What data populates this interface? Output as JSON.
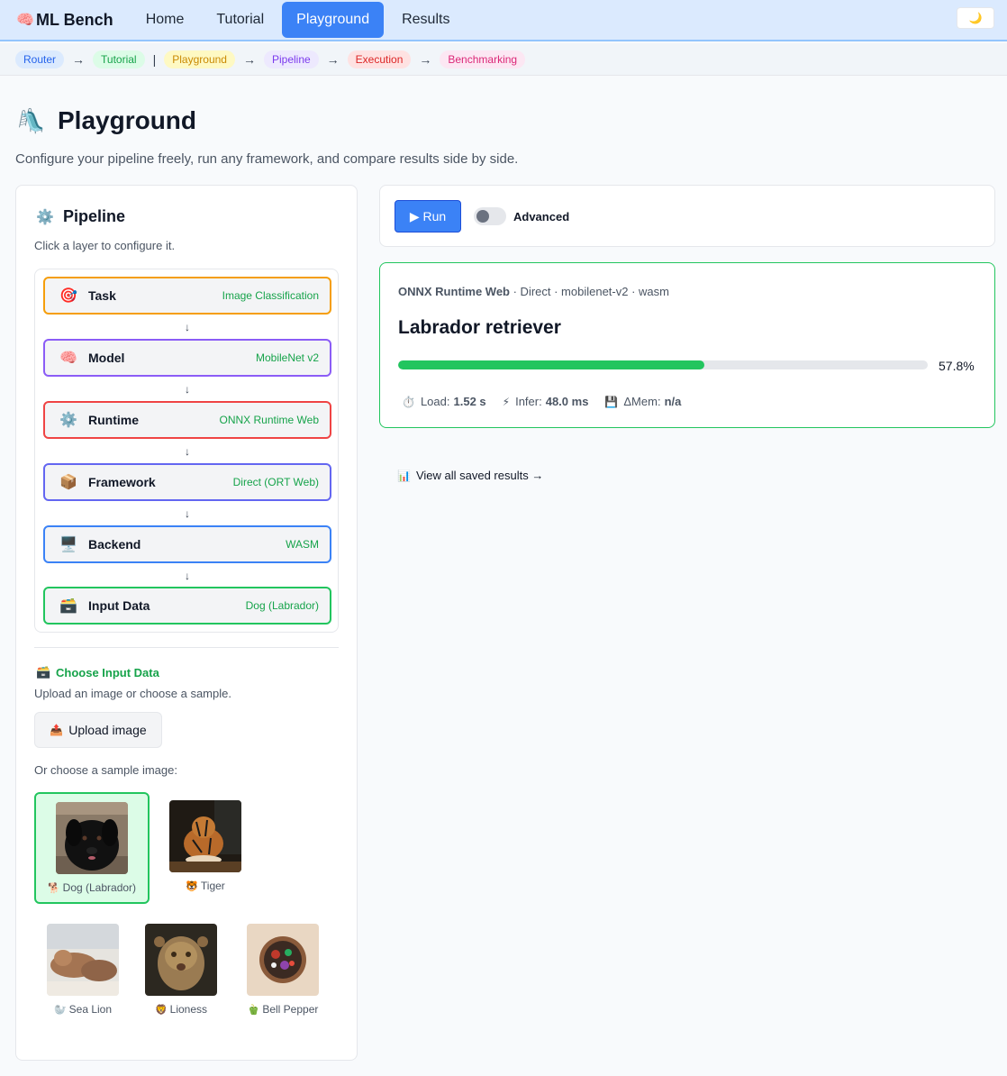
{
  "nav": {
    "brand": "ML Bench",
    "brand_icon": "🧠",
    "links": [
      "Home",
      "Tutorial",
      "Playground",
      "Results"
    ],
    "active": "Playground",
    "theme_icon": "🌙"
  },
  "breadcrumb": {
    "items": [
      "Router",
      "Tutorial",
      "Playground",
      "Pipeline",
      "Execution",
      "Benchmarking"
    ],
    "separators": [
      "→",
      "|",
      "→",
      "→",
      "→"
    ]
  },
  "header": {
    "icon": "🛝",
    "title": "Playground",
    "subtitle": "Configure your pipeline freely, run any framework, and compare results side by side."
  },
  "pipeline": {
    "icon": "⚙️",
    "title": "Pipeline",
    "hint": "Click a layer to configure it.",
    "arrow": "↓",
    "layers": [
      {
        "icon": "🎯",
        "name": "Task",
        "value": "Image Classification",
        "color": "#f59e0b"
      },
      {
        "icon": "🧠",
        "name": "Model",
        "value": "MobileNet v2",
        "color": "#8b5cf6"
      },
      {
        "icon": "⚙️",
        "name": "Runtime",
        "value": "ONNX Runtime Web",
        "color": "#ef4444"
      },
      {
        "icon": "📦",
        "name": "Framework",
        "value": "Direct (ORT Web)",
        "color": "#6366f1"
      },
      {
        "icon": "🖥️",
        "name": "Backend",
        "value": "WASM",
        "color": "#3b82f6"
      },
      {
        "icon": "🗃️",
        "name": "Input Data",
        "value": "Dog (Labrador)",
        "color": "#22c55e"
      }
    ]
  },
  "input": {
    "icon": "🗃️",
    "title": "Choose Input Data",
    "hint": "Upload an image or choose a sample.",
    "upload_icon": "📤",
    "upload_label": "Upload image",
    "sample_hint": "Or choose a sample image:",
    "samples": [
      {
        "icon": "🐕",
        "label": "Dog (Labrador)",
        "selected": true
      },
      {
        "icon": "🐯",
        "label": "Tiger",
        "selected": false
      },
      {
        "icon": "🦭",
        "label": "Sea Lion",
        "selected": false
      },
      {
        "icon": "🦁",
        "label": "Lioness",
        "selected": false
      },
      {
        "icon": "🫑",
        "label": "Bell Pepper",
        "selected": false
      }
    ]
  },
  "controls": {
    "run_label": "▶ Run",
    "advanced_label": "Advanced",
    "advanced_on": false
  },
  "result": {
    "runtime": "ONNX Runtime Web",
    "details": " · Direct · mobilenet-v2 · wasm",
    "label": "Labrador retriever",
    "confidence": 0.578,
    "confidence_text": "57.8%",
    "load_icon": "⏱️",
    "load_label": "Load:",
    "load_value": "1.52 s",
    "infer_icon": "⚡",
    "infer_label": "Infer:",
    "infer_value": "48.0 ms",
    "mem_icon": "💾",
    "mem_label": "ΔMem:",
    "mem_value": "n/a"
  },
  "view_link": {
    "icon": "📊",
    "label": "View all saved results →"
  }
}
